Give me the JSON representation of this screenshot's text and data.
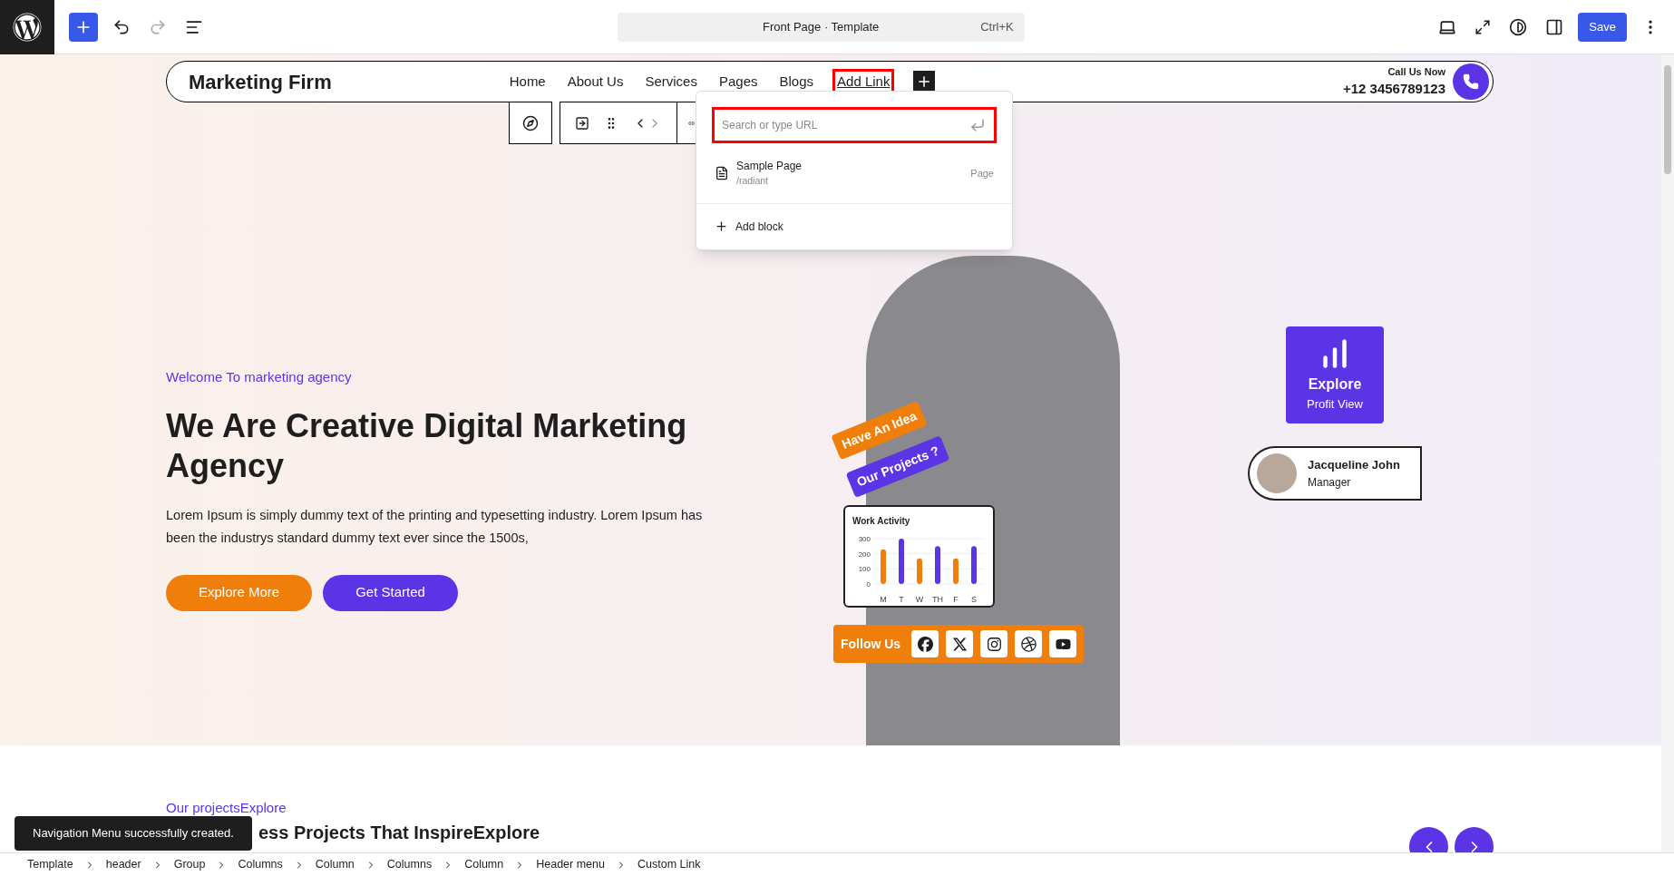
{
  "topbar": {
    "document_title": "Front Page · Template",
    "shortcut": "Ctrl+K",
    "save": "Save"
  },
  "header": {
    "logo": "Marketing Firm",
    "nav": [
      {
        "label": "Home",
        "selected": false
      },
      {
        "label": "About Us",
        "selected": false
      },
      {
        "label": "Services",
        "selected": false
      },
      {
        "label": "Pages",
        "selected": false
      },
      {
        "label": "Blogs",
        "selected": false
      },
      {
        "label": "Add Link",
        "selected": true
      }
    ],
    "call_label": "Call Us Now",
    "phone": "+12 3456789123"
  },
  "link_popup": {
    "placeholder": "Search or type URL",
    "results": [
      {
        "title": "Sample Page",
        "path": "/radiant",
        "type": "Page"
      }
    ],
    "add_block": "Add block"
  },
  "hero": {
    "eyebrow": "Welcome To marketing agency",
    "heading": "We Are Creative Digital Marketing Agency",
    "text": "Lorem Ipsum is simply dummy text of the printing and typesetting industry. Lorem Ipsum has been the industrys standard dummy text ever since the 1500s,",
    "buttons": [
      {
        "label": "Explore More",
        "kind": "orange"
      },
      {
        "label": "Get Started",
        "kind": "purple"
      }
    ],
    "tags": [
      {
        "label": "Have An Idea",
        "color": "#ef7f0a"
      },
      {
        "label": "Our Projects ?",
        "color": "#5b34e6"
      }
    ],
    "explore_card": {
      "title": "Explore",
      "subtitle": "Profit View"
    },
    "person_card": {
      "name": "Jacqueline John",
      "role": "Manager"
    },
    "work_activity": {
      "title": "Work Activity",
      "chart_data": {
        "type": "bar",
        "categories": [
          "M",
          "T",
          "W",
          "TH",
          "F",
          "S"
        ],
        "series": [
          {
            "color": "#ef7f0a",
            "values": [
              230,
              null,
              170,
              null,
              170,
              null
            ]
          },
          {
            "color": "#5b34e6",
            "values": [
              null,
              300,
              null,
              250,
              null,
              250
            ]
          }
        ],
        "yticks": [
          0,
          100,
          200,
          300
        ],
        "ylim": [
          0,
          300
        ]
      }
    },
    "follow_label": "Follow Us"
  },
  "projects": {
    "eyebrow": "Our projectsExplore",
    "heading": "ess Projects That InspireExplore"
  },
  "toast": "Navigation Menu successfully created.",
  "breadcrumbs": [
    "Template",
    "header",
    "Group",
    "Columns",
    "Column",
    "Columns",
    "Column",
    "Header menu",
    "Custom Link"
  ]
}
